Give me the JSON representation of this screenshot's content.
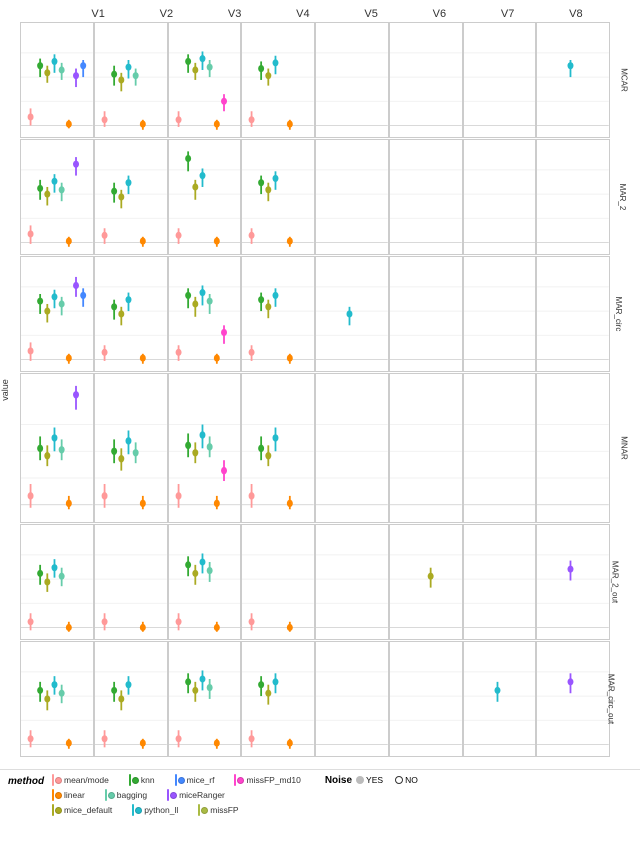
{
  "columns": [
    "V1",
    "V2",
    "V3",
    "V4",
    "V5",
    "V6",
    "V7",
    "V8"
  ],
  "rows": [
    "MCAR",
    "MAR_2",
    "MAR_circ",
    "MNAR",
    "MAR_2_out",
    "MAR_circ_out"
  ],
  "yAxisLabel": "value",
  "legend": {
    "methods": [
      {
        "name": "mean/mode",
        "color": "#FF9999"
      },
      {
        "name": "knn",
        "color": "#33AA33"
      },
      {
        "name": "mice_rf",
        "color": "#4488FF"
      },
      {
        "name": "missFP_md10",
        "color": "#FF44CC"
      },
      {
        "name": "linear",
        "color": "#FF8800"
      },
      {
        "name": "bagging",
        "color": "#66CCAA"
      },
      {
        "name": "miceRanger",
        "color": "#9955FF"
      },
      {
        "name": "mice_default",
        "color": "#AAAA22"
      },
      {
        "name": "python_ll",
        "color": "#22BBCC"
      },
      {
        "name": "missFP",
        "color": "#AABB44"
      }
    ],
    "noise": {
      "label": "Noise",
      "yes": "YES",
      "no": "NO"
    }
  }
}
